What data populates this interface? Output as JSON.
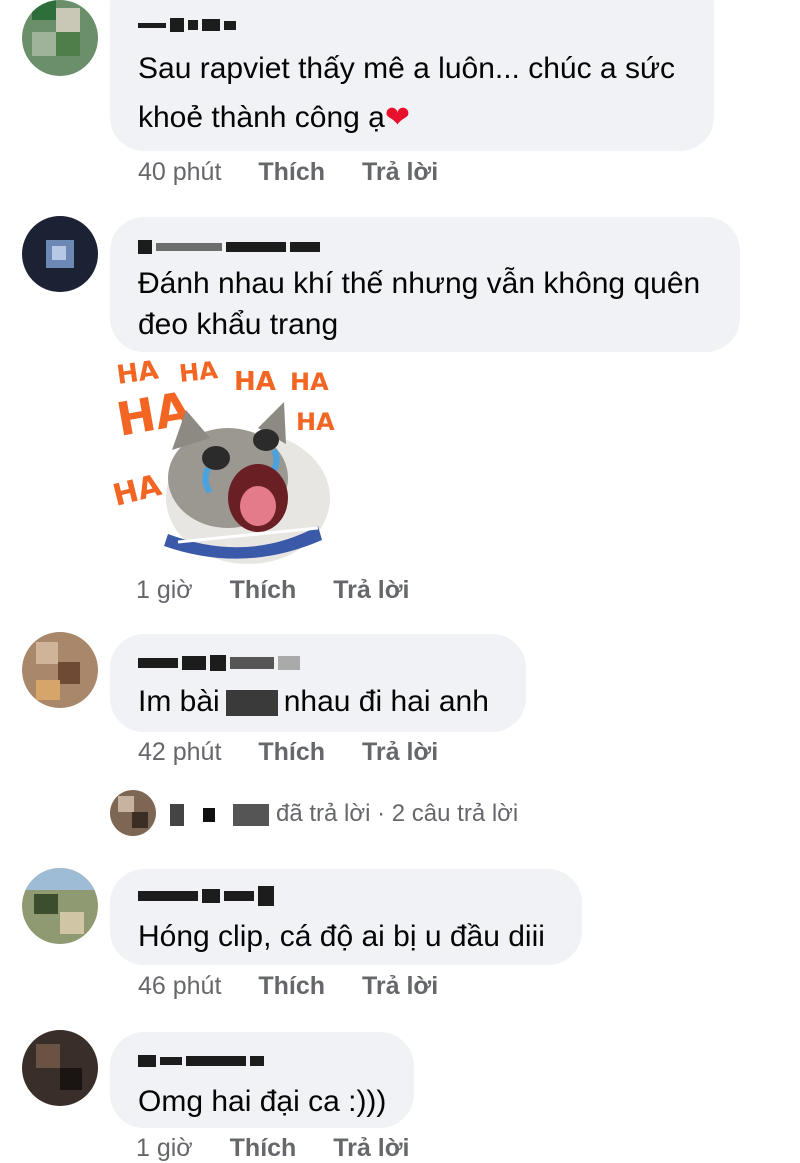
{
  "comments": [
    {
      "text_line1": "Sau rapviet thấy mê a luôn... chúc a sức",
      "text_line2": "khoẻ thành công ạ",
      "heart": "❤",
      "time": "40 phút",
      "like": "Thích",
      "reply": "Trả lời"
    },
    {
      "text_line1": "Đánh nhau khí thế nhưng vẫn không quên",
      "text_line2": "đeo khẩu trang",
      "time": "1 giờ",
      "like": "Thích",
      "reply": "Trả lời"
    },
    {
      "text_before": "Im bài",
      "text_after": "nhau đi hai anh",
      "time": "42 phút",
      "like": "Thích",
      "reply": "Trả lời",
      "replies_summary": "đã trả lời · 2 câu trả lời"
    },
    {
      "text": "Hóng clip, cá độ ai bị u đầu diii",
      "time": "46 phút",
      "like": "Thích",
      "reply": "Trả lời"
    },
    {
      "text": "Omg hai đại ca :)))",
      "time": "1 giờ",
      "like": "Thích",
      "reply": "Trả lời"
    }
  ],
  "sticker": {
    "words": [
      "HA",
      "HA",
      "HA",
      "HA",
      "HA",
      "HA",
      "HA"
    ]
  },
  "colors": {
    "bubble": "#f0f2f5",
    "meta_text": "#65676b",
    "sticker_text": "#f26522"
  }
}
